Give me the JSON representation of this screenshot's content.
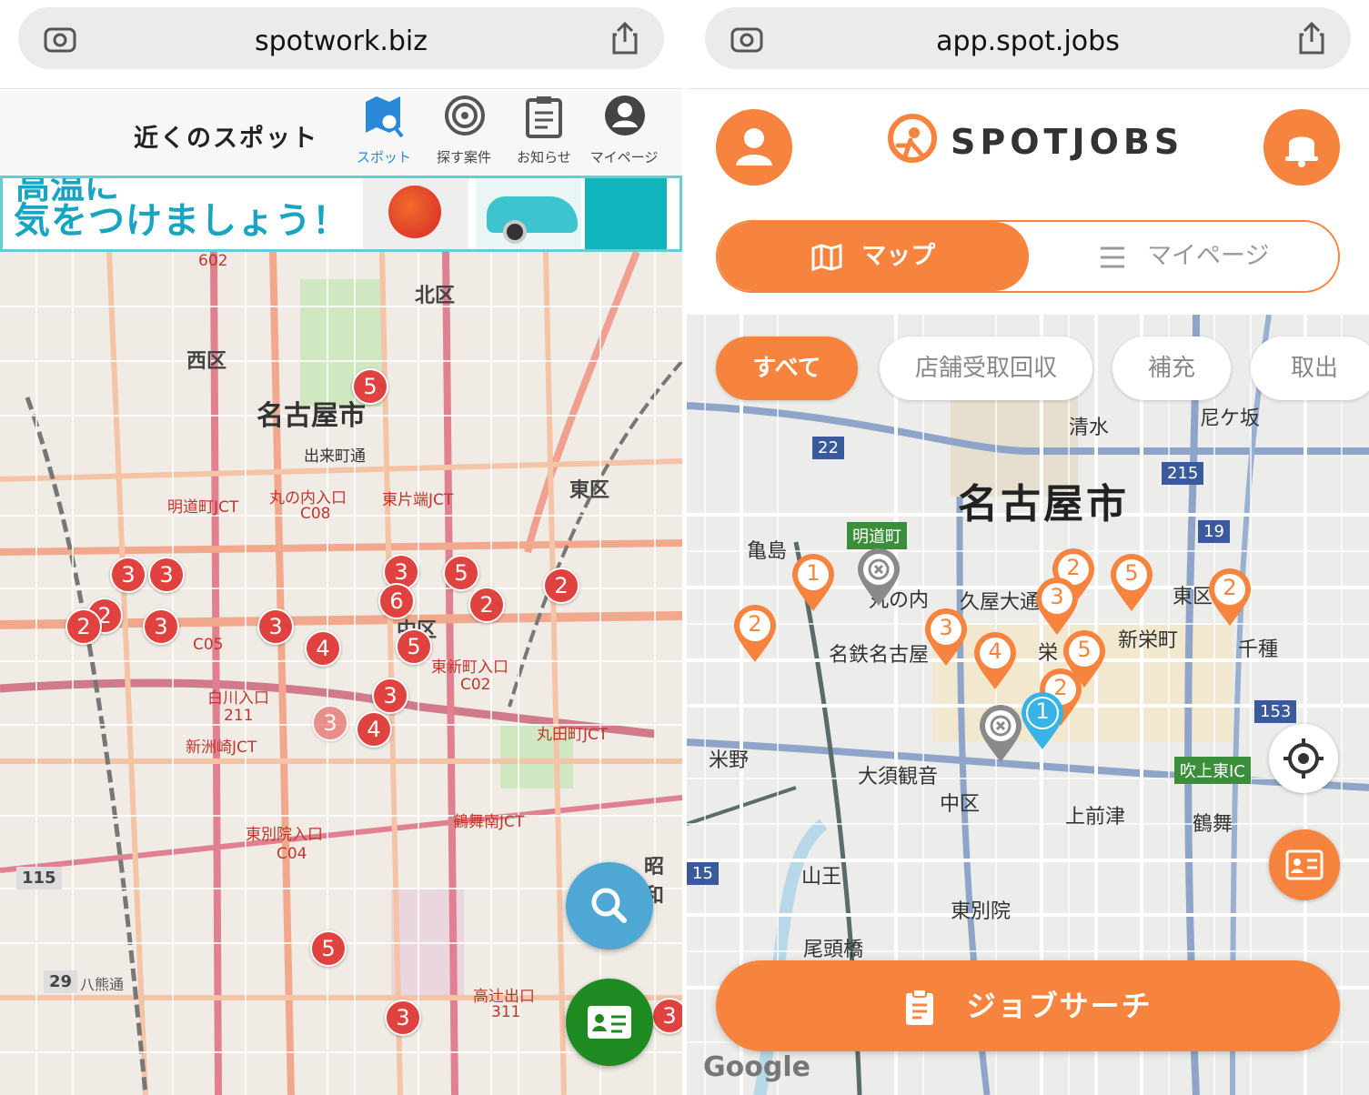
{
  "left": {
    "browser": {
      "url": "spotwork.biz"
    },
    "header": {
      "title": "近くのスポット",
      "nav": [
        {
          "label": "スポット",
          "icon": "map-search-icon",
          "active": true
        },
        {
          "label": "探す案件",
          "icon": "target-icon",
          "active": false
        },
        {
          "label": "お知らせ",
          "icon": "clipboard-icon",
          "active": false
        },
        {
          "label": "マイページ",
          "icon": "account-icon",
          "active": false
        }
      ]
    },
    "banner": {
      "line1": "高温に",
      "line2": "気をつけましょう！"
    },
    "map": {
      "labels": {
        "meieki_n": "西区",
        "kita": "北区",
        "nagoya": "名古屋市",
        "higashi": "東区",
        "naka": "中区",
        "showa": "昭和",
        "demachi": "出来町通",
        "maru": "丸の内入口",
        "higashikata": "東片端JCT",
        "meidou": "明道町JCT",
        "shirakawa": "白川入口",
        "shinsu": "新洲崎JCT",
        "higashishin": "東新町入口",
        "marutamachi": "丸田町JCT",
        "tsurumai": "鶴舞南JCT",
        "higashibetsu": "東別院入口",
        "takatsuji": "高辻出口",
        "r115": "115",
        "r29": "29",
        "hatta": "八熊通",
        "c08": "C08",
        "c05": "C05",
        "c04": "C04",
        "c02": "C02",
        "n602": "602",
        "n211": "211",
        "n311": "311"
      },
      "markers": [
        "5",
        "3",
        "3",
        "2",
        "2",
        "3",
        "3",
        "3",
        "6",
        "5",
        "2",
        "2",
        "3",
        "4",
        "5",
        "3",
        "4",
        "5",
        "3",
        "3"
      ]
    }
  },
  "right": {
    "browser": {
      "url": "app.spot.jobs"
    },
    "header": {
      "logo": "SPOTJOBS",
      "tabs": {
        "map": "マップ",
        "mypage": "マイページ"
      }
    },
    "filters": [
      "すべて",
      "店舗受取回収",
      "補充",
      "取出"
    ],
    "map": {
      "labels": {
        "nagoya": "名古屋市",
        "shimizu": "清水",
        "amagasaka": "尼ケ坂",
        "meidou": "明道町",
        "kamejima": "亀島",
        "marunouchi": "丸の内",
        "hisaya": "久屋大通",
        "higashiku": "東区",
        "shinsakae": "新栄町",
        "chikusa": "千種",
        "sakae": "栄",
        "meitetsu": "名鉄名古屋",
        "yoneno": "米野",
        "osu": "大須観音",
        "nakaku": "中区",
        "kamimaezu": "上前津",
        "tsurumai": "鶴舞",
        "sanno": "山王",
        "higashibetsuin": "東別院",
        "ozubashi": "尾頭橋",
        "fukiage": "吹上東IC",
        "r22": "22",
        "r215": "215",
        "r19": "19",
        "r153": "153",
        "r15": "15"
      },
      "pins": [
        "1",
        "2",
        "5",
        "2",
        "2",
        "3",
        "3",
        "4",
        "5",
        "2",
        "1"
      ],
      "google": "Google"
    },
    "jobsearch": "ジョブサーチ"
  },
  "colors": {
    "accent": "#f6843e",
    "marker": "#e0433f",
    "spotBlue": "#2a88d8"
  }
}
